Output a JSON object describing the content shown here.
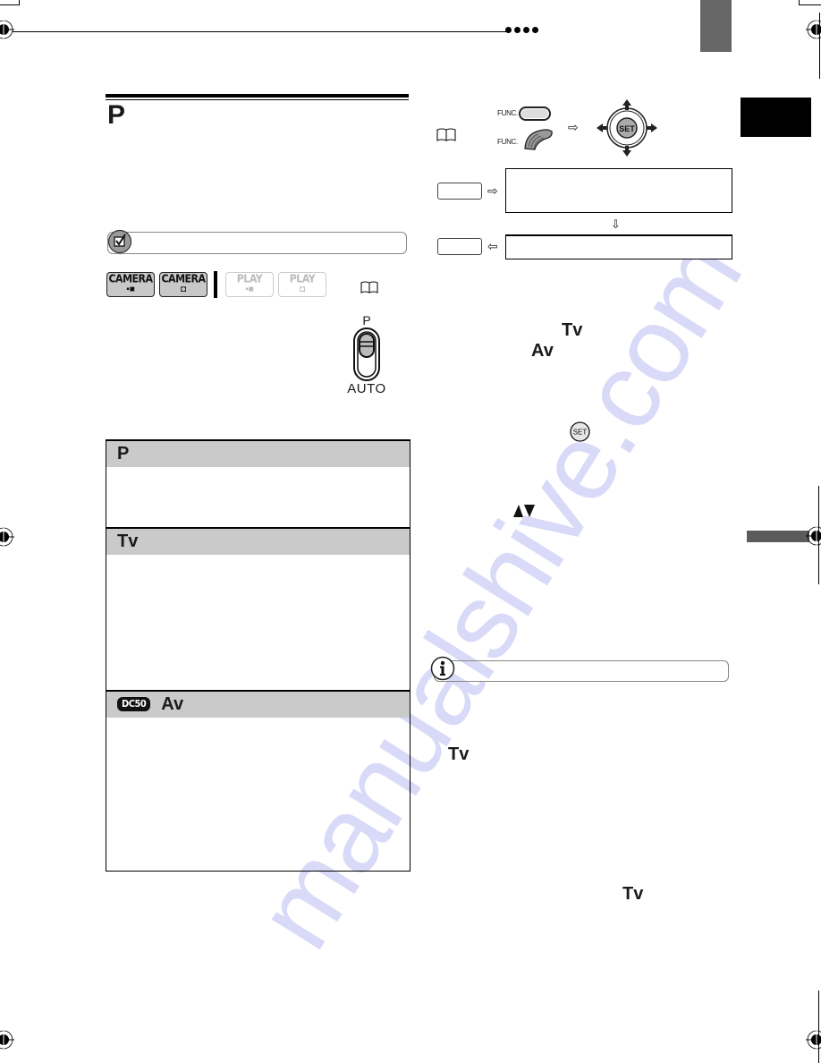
{
  "page": {
    "header_dots_count": 4,
    "watermark": "manualshive.com"
  },
  "left_column": {
    "section_title_glyph": "P",
    "check_icon": "checkmark-box-icon",
    "mode_badges": [
      {
        "label": "CAMERA",
        "icon": "video-camera-icon",
        "active": true
      },
      {
        "label": "CAMERA",
        "icon": "still-camera-icon",
        "active": true
      },
      {
        "label": "PLAY",
        "icon": "video-camera-icon",
        "active": false
      },
      {
        "label": "PLAY",
        "icon": "still-camera-icon",
        "active": false
      }
    ],
    "reference_icon": "book-icon",
    "mode_switch": {
      "top_label": "P",
      "bottom_label": "AUTO"
    },
    "modes_table": [
      {
        "glyph": "P",
        "badge": ""
      },
      {
        "glyph": "Tv",
        "badge": ""
      },
      {
        "glyph": "Av",
        "badge": "DC50"
      }
    ]
  },
  "right_column": {
    "reference_icon": "book-icon",
    "func_labels": [
      "FUNC.",
      "FUNC."
    ],
    "joystick_center_label": "SET",
    "flow_arrows": {
      "right1": "⇨",
      "right2": "⇨",
      "down": "⇩",
      "left": "⇦"
    },
    "inline_glyphs": {
      "tv_step": "Tv",
      "av_step": "Av",
      "set_icon": "SET",
      "tv_note1": "Tv",
      "tv_note2": "Tv"
    },
    "info_icon": "info-icon"
  }
}
